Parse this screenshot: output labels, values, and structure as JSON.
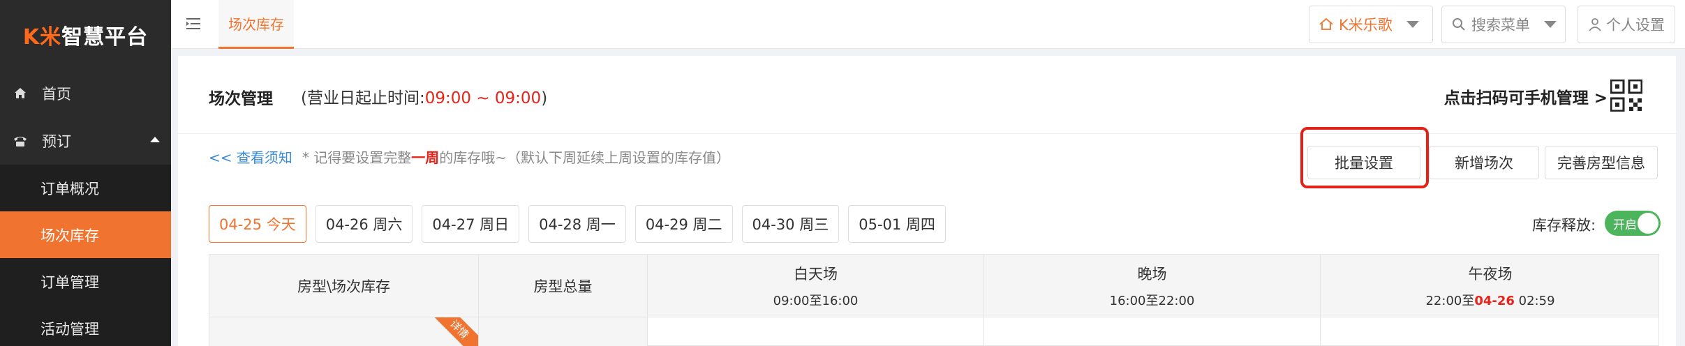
{
  "sidebar": {
    "logo_k": "K米",
    "logo_rest": "智慧平台",
    "items": [
      {
        "label": "首页",
        "icon": "home-icon"
      },
      {
        "label": "预订",
        "icon": "phone-icon"
      }
    ],
    "subitems": [
      {
        "label": "订单概况"
      },
      {
        "label": "场次库存"
      },
      {
        "label": "订单管理"
      },
      {
        "label": "活动管理"
      }
    ]
  },
  "topbar": {
    "active_tab": "场次库存",
    "store": "K米乐歌",
    "search": "搜索菜单",
    "settings": "个人设置"
  },
  "header": {
    "title": "场次管理",
    "hours_prefix": "(营业日起止时间:",
    "hours_value": "09:00 ~ 09:00",
    "hours_suffix": ")",
    "scan": "点击扫码可手机管理 >"
  },
  "notice": {
    "link": "<< 查看须知",
    "text_a": "* 记得要设置完整",
    "text_b": "一周",
    "text_c": "的库存哦~（默认下周延续上周设置的库存值）"
  },
  "actions": {
    "bulk": "批量设置",
    "add": "新增场次",
    "room": "完善房型信息"
  },
  "dates": [
    "04-25 今天",
    "04-26 周六",
    "04-27 周日",
    "04-28 周一",
    "04-29 周二",
    "04-30 周三",
    "05-01 周四"
  ],
  "release": {
    "label": "库存释放:",
    "switch": "开启"
  },
  "table": {
    "col_room": "房型\\场次库存",
    "col_total": "房型总量",
    "day_name": "白天场",
    "day_time": "09:00至16:00",
    "eve_name": "晚场",
    "eve_time": "16:00至22:00",
    "mid_name": "午夜场",
    "mid_time_a": "22:00至",
    "mid_time_b": "04-26",
    "mid_time_c": " 02:59",
    "ribbon": "详情"
  },
  "colors": {
    "accent": "#f0742f",
    "red": "#e8231a",
    "sidebar": "#2b2b2b",
    "switch_on": "#4cb45c"
  }
}
